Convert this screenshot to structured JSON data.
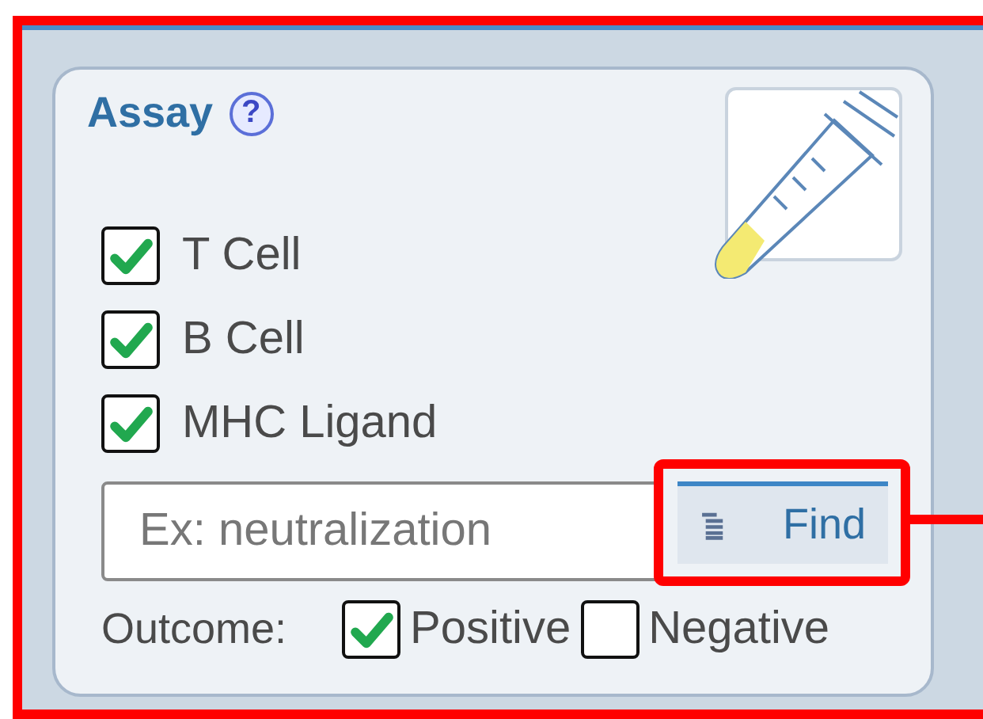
{
  "panel": {
    "title": "Assay",
    "help_icon": "?"
  },
  "assay_types": [
    {
      "label": "T Cell",
      "checked": true
    },
    {
      "label": "B Cell",
      "checked": true
    },
    {
      "label": "MHC Ligand",
      "checked": true
    }
  ],
  "search": {
    "placeholder": "Ex: neutralization",
    "button": "Find"
  },
  "outcome": {
    "label": "Outcome:",
    "options": [
      {
        "label": "Positive",
        "checked": true
      },
      {
        "label": "Negative",
        "checked": false
      }
    ]
  }
}
